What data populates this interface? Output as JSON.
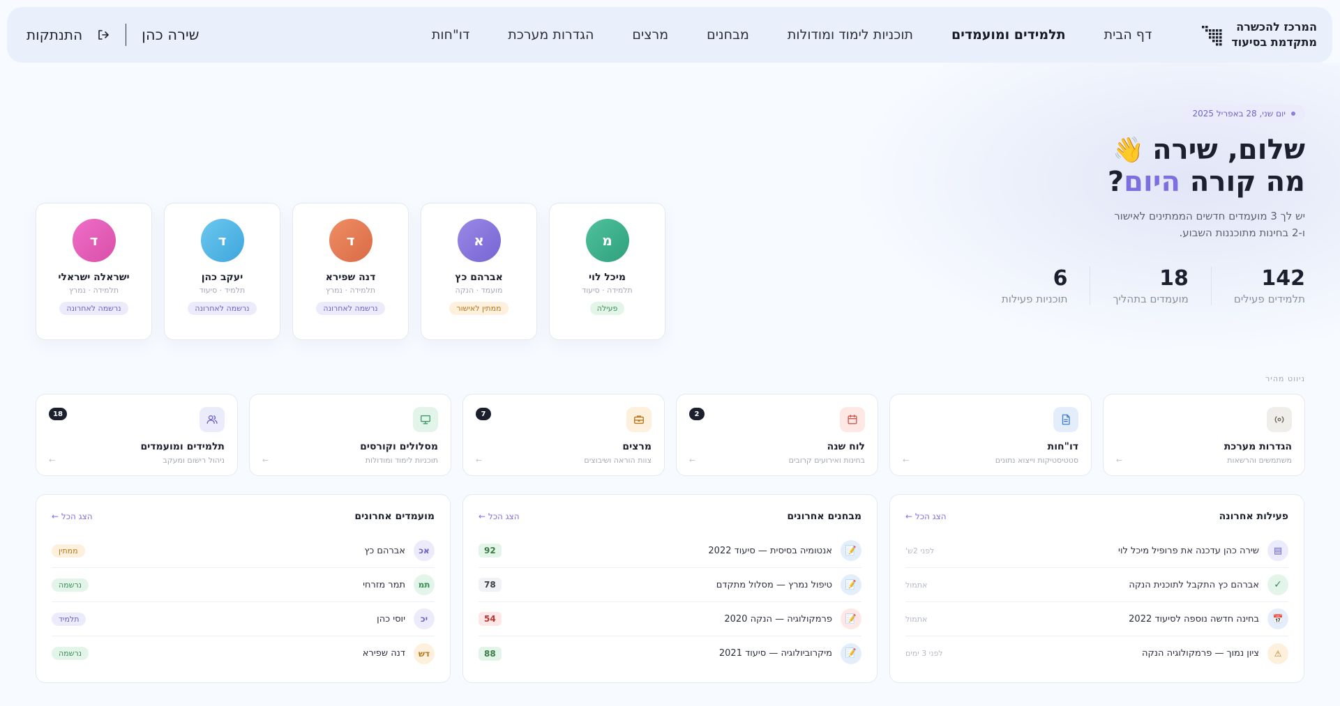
{
  "brand": {
    "line1": "המרכז להכשרה",
    "line2": "מתקדמת בסיעוד"
  },
  "nav": {
    "items": [
      {
        "label": "דף הבית"
      },
      {
        "label": "תלמידים ומועמדים"
      },
      {
        "label": "תוכניות לימוד ומודולות"
      },
      {
        "label": "מבחנים"
      },
      {
        "label": "מרצים"
      },
      {
        "label": "הגדרות מערכת"
      },
      {
        "label": "דו\"חות"
      }
    ],
    "user_name": "שירה כהן",
    "logout_label": "התנתקות"
  },
  "hero": {
    "date": "יום שני, 28 באפריל 2025",
    "greeting": "שלום, שירה",
    "wave": "👋",
    "line2_prefix": "מה קורה",
    "line2_accent": "היום",
    "line2_suffix": "?",
    "sub1": "יש לך 3 מועמדים חדשים הממתינים לאישור",
    "sub2": "ו-2 בחינות מתוכננות השבוע."
  },
  "stats": [
    {
      "value": "142",
      "label": "תלמידים פעילים"
    },
    {
      "value": "18",
      "label": "מועמדים בתהליך"
    },
    {
      "value": "6",
      "label": "תוכניות פעילות"
    }
  ],
  "people": [
    {
      "initial": "ד",
      "name": "ישראלה ישראלי",
      "role": "תלמידה · נמרץ",
      "status": "נרשמה לאחרונה",
      "color": "#e35fb8"
    },
    {
      "initial": "ד",
      "name": "יעקב כהן",
      "role": "תלמיד · סיעוד",
      "status": "נרשמה לאחרונה",
      "color": "#55b8e6"
    },
    {
      "initial": "ד",
      "name": "דנה שפירא",
      "role": "תלמידה · נמרץ",
      "status": "נרשמה לאחרונה",
      "color": "#e27d56"
    },
    {
      "initial": "א",
      "name": "אברהם כץ",
      "role": "מועמד · הנקה",
      "status": "ממתין לאישור",
      "color": "#8a76dd"
    },
    {
      "initial": "מ",
      "name": "מיכל לוי",
      "role": "תלמידה · סיעוד",
      "status": "פעילה",
      "color": "#3eb08c"
    }
  ],
  "quick_nav": {
    "title": "ניווט מהיר",
    "items": [
      {
        "name": "תלמידים ומועמדים",
        "desc": "ניהול רישום ומעקב",
        "badge": "18",
        "icon": "users-icon"
      },
      {
        "name": "מסלולים וקורסים",
        "desc": "תוכניות לימוד ומודולות",
        "badge": "",
        "icon": "monitor-icon"
      },
      {
        "name": "מרצים",
        "desc": "צוות הוראה ושיבוצים",
        "badge": "7",
        "icon": "briefcase-icon"
      },
      {
        "name": "לוח שנה",
        "desc": "בחינות ואירועים קרובים",
        "badge": "2",
        "icon": "calendar-icon"
      },
      {
        "name": "דו\"חות",
        "desc": "סטטיסטיקות וייצוא נתונים",
        "badge": "",
        "icon": "document-icon"
      },
      {
        "name": "הגדרות מערכת",
        "desc": "משתמשים והרשאות",
        "badge": "",
        "icon": "settings-icon"
      }
    ],
    "arrow": "←"
  },
  "panels": {
    "view_all": "הצג הכל ←",
    "candidates": {
      "title": "מועמדים אחרונים",
      "rows": [
        {
          "initials": "אכ",
          "name": "אברהם כץ",
          "status": "ממתין"
        },
        {
          "initials": "תמ",
          "name": "תמר מזרחי",
          "status": "נרשמה"
        },
        {
          "initials": "יכ",
          "name": "יוסי כהן",
          "status": "תלמיד"
        },
        {
          "initials": "דש",
          "name": "דנה שפירא",
          "status": "נרשמה"
        }
      ]
    },
    "exams": {
      "title": "מבחנים אחרונים",
      "rows": [
        {
          "name": "אנטומיה בסיסית — סיעוד 2022",
          "score": "92"
        },
        {
          "name": "טיפול נמרץ — מסלול מתקדם",
          "score": "78"
        },
        {
          "name": "פרמקולוגיה — הנקה 2020",
          "score": "54"
        },
        {
          "name": "מיקרוביולוגיה — סיעוד 2021",
          "score": "88"
        }
      ]
    },
    "activity": {
      "title": "פעילות אחרונה",
      "rows": [
        {
          "text": "שירה כהן עדכנה את פרופיל מיכל לוי",
          "time": "לפני 2ש'"
        },
        {
          "text": "אברהם כץ התקבל לתוכנית הנקה",
          "time": "אתמול"
        },
        {
          "text": "בחינה חדשה נוספה לסיעוד 2022",
          "time": "אתמול"
        },
        {
          "text": "ציון נמוך — פרמקולוגיה הנקה",
          "time": "לפני 3 ימים"
        }
      ]
    }
  },
  "colors": {
    "accent": "#7d6fe0",
    "nav_bg": "#e9f0fb",
    "page_bg": "#f7faff"
  }
}
